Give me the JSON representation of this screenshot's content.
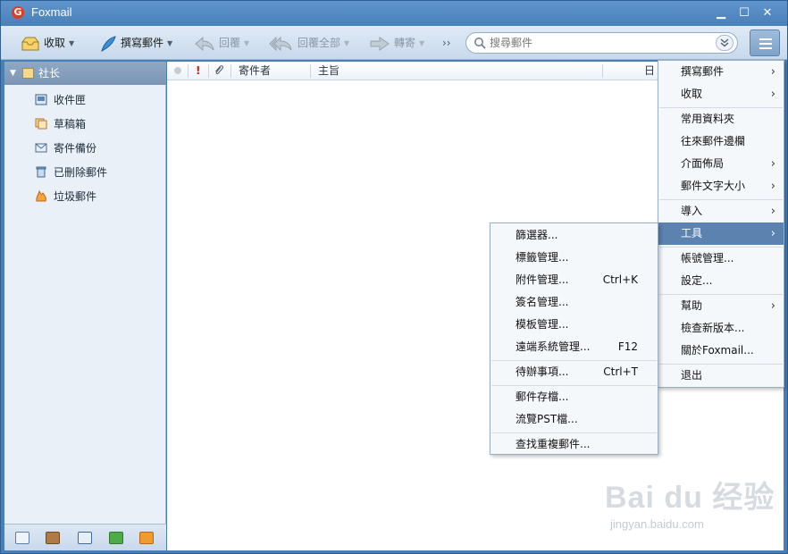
{
  "app": {
    "title": "Foxmail",
    "logo_letter": "G"
  },
  "window_controls": {
    "minimize": "▁",
    "maximize": "☐",
    "close": "✕"
  },
  "toolbar": {
    "receive": "收取",
    "compose": "撰寫郵件",
    "reply": "回覆",
    "reply_all": "回覆全部",
    "forward": "轉寄",
    "more": "››"
  },
  "search": {
    "placeholder": "搜尋郵件"
  },
  "sidebar": {
    "account": "社长",
    "folders": [
      {
        "label": "收件匣",
        "icon": "inbox-icon"
      },
      {
        "label": "草稿箱",
        "icon": "drafts-icon"
      },
      {
        "label": "寄件備份",
        "icon": "sent-icon"
      },
      {
        "label": "已刪除郵件",
        "icon": "trash-icon"
      },
      {
        "label": "垃圾郵件",
        "icon": "junk-icon"
      }
    ]
  },
  "list": {
    "columns": {
      "flag": "!",
      "sender": "寄件者",
      "subject": "主旨",
      "date": "日"
    }
  },
  "main_menu": {
    "items": [
      {
        "label": "撰寫郵件",
        "submenu": true
      },
      {
        "label": "收取",
        "submenu": true
      },
      {
        "label": "常用資料夾",
        "submenu": false
      },
      {
        "label": "往來郵件邊欄",
        "submenu": false
      },
      {
        "label": "介面佈局",
        "submenu": true
      },
      {
        "label": "郵件文字大小",
        "submenu": true
      },
      {
        "label": "導入",
        "submenu": true
      },
      {
        "label": "工具",
        "submenu": true,
        "active": true
      },
      {
        "label": "帳號管理...",
        "submenu": false
      },
      {
        "label": "設定...",
        "submenu": false
      },
      {
        "label": "幫助",
        "submenu": true
      },
      {
        "label": "檢查新版本...",
        "submenu": false
      },
      {
        "label": "關於Foxmail...",
        "submenu": false
      },
      {
        "label": "退出",
        "submenu": false
      }
    ],
    "chevron": "›"
  },
  "tools_menu": {
    "items": [
      {
        "label": "篩選器...",
        "shortcut": ""
      },
      {
        "label": "標籤管理...",
        "shortcut": ""
      },
      {
        "label": "附件管理...",
        "shortcut": "Ctrl+K"
      },
      {
        "label": "簽名管理...",
        "shortcut": ""
      },
      {
        "label": "模板管理...",
        "shortcut": ""
      },
      {
        "label": "遠端系統管理...",
        "shortcut": "F12"
      },
      {
        "label": "待辦事項...",
        "shortcut": "Ctrl+T"
      },
      {
        "label": "郵件存檔...",
        "shortcut": ""
      },
      {
        "label": "流覽PST檔...",
        "shortcut": ""
      },
      {
        "label": "查找重複郵件...",
        "shortcut": ""
      }
    ]
  },
  "watermark": {
    "brand": "Bai du 经验",
    "url": "jingyan.baidu.com"
  }
}
